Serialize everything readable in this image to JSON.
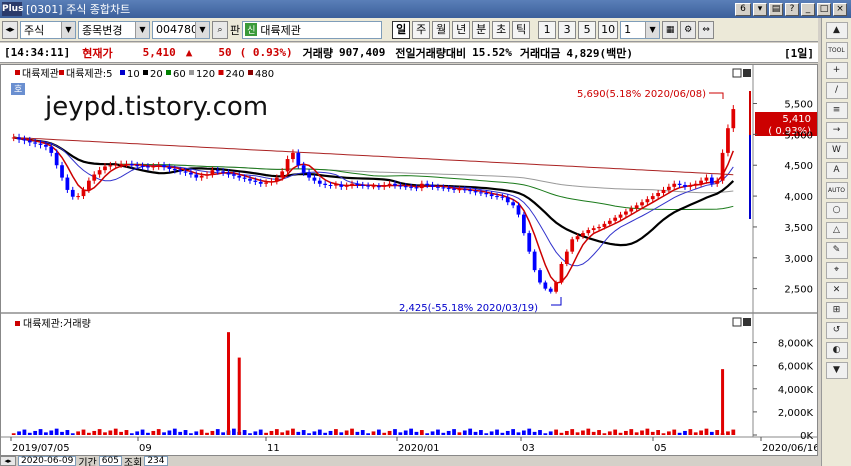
{
  "window": {
    "app_icon": "Plus",
    "title": "[0301] 주식 종합차트",
    "screen_number": "6",
    "controls": [
      "▾",
      "▤",
      "?",
      "_",
      "□",
      "×"
    ]
  },
  "toolbar": {
    "market": "주식",
    "mode": "종목변경",
    "code": "004780",
    "name_prefix": "판",
    "credit_tag": "신",
    "stock_name": "대륙제관",
    "periods": [
      "일",
      "주",
      "월",
      "년",
      "분",
      "초",
      "틱"
    ],
    "active_period": "일",
    "minute_buttons": [
      "1",
      "3",
      "5",
      "10"
    ],
    "interval_value": "1"
  },
  "quote": {
    "time": "[14:34:11]",
    "price_label": "현재가",
    "price": "5,410",
    "arrow": "▲",
    "change": "50",
    "change_pct": "( 0.93%)",
    "volume_label": "거래량",
    "volume": "907,409",
    "vol_ratio_label": "전일거래량대비",
    "vol_ratio": "15.52%",
    "amount_label": "거래대금",
    "amount": "4,829(백만)",
    "period_tag": "[1일]"
  },
  "watermark": "jeypd.tistory.com",
  "price_panel": {
    "legend": [
      "대륙제관",
      "대륙제관:5",
      "10",
      "20",
      "60",
      "120",
      "240",
      "480"
    ],
    "legend_colors": [
      "#cc0000",
      "#cc0000",
      "#0000cc",
      "#000000",
      "#008000",
      "#999999",
      "#cc0000",
      "#8b0000"
    ],
    "hoga_tag": "호",
    "max_annotation": "5,690(5.18% 2020/06/08)",
    "min_annotation": "2,425(-55.18% 2020/03/19)",
    "current_label": "5,410",
    "current_pct": "( 0.93%)",
    "y_ticks": [
      "5,500",
      "5,000",
      "4,500",
      "4,000",
      "3,500",
      "3,000",
      "2,500"
    ]
  },
  "volume_panel": {
    "legend": "대륙제관:거래량",
    "y_ticks": [
      "8,000K",
      "6,000K",
      "4,000K",
      "2,000K",
      "0K"
    ]
  },
  "x_axis": {
    "labels": [
      "2019/07/05",
      "09",
      "11",
      "2020/01",
      "03",
      "05",
      "2020/06/16"
    ]
  },
  "bottom": {
    "date": "2020-06-09",
    "period_label": "기간",
    "period_value": "605",
    "query_label": "조회",
    "query_value": "234"
  },
  "right_tools": [
    "▲",
    "TOOL",
    "+",
    "/",
    "≡",
    "→",
    "W",
    "A",
    "AUTO",
    "○",
    "△",
    "✎",
    "⌖",
    "✕",
    "⊞",
    "↺",
    "◐",
    "▼"
  ],
  "colors": {
    "up": "#e00000",
    "down": "#0000ff",
    "ma5": "#cc0000",
    "ma10": "#3333cc",
    "ma20": "#000000",
    "ma60": "#1a7a1a",
    "ma120": "#999999",
    "ma240": "#aa2222"
  },
  "chart_data": {
    "type": "candlestick",
    "x_start": "2019/07/05",
    "x_end": "2020/06/16",
    "price_ylim": [
      2300,
      5800
    ],
    "close_series": [
      4950,
      4920,
      4900,
      4870,
      4850,
      4830,
      4800,
      4700,
      4500,
      4300,
      4100,
      3990,
      4000,
      4100,
      4250,
      4350,
      4420,
      4480,
      4500,
      4510,
      4520,
      4520,
      4500,
      4490,
      4480,
      4470,
      4480,
      4500,
      4470,
      4440,
      4420,
      4400,
      4380,
      4350,
      4300,
      4330,
      4350,
      4420,
      4400,
      4380,
      4350,
      4330,
      4300,
      4280,
      4250,
      4230,
      4200,
      4220,
      4240,
      4300,
      4400,
      4600,
      4700,
      4500,
      4380,
      4300,
      4250,
      4200,
      4180,
      4170,
      4190,
      4150,
      4170,
      4200,
      4180,
      4170,
      4160,
      4160,
      4150,
      4180,
      4200,
      4170,
      4160,
      4150,
      4140,
      4130,
      4200,
      4180,
      4150,
      4140,
      4130,
      4120,
      4100,
      4110,
      4100,
      4080,
      4060,
      4050,
      4030,
      4000,
      3990,
      3980,
      3900,
      3850,
      3700,
      3400,
      3100,
      2800,
      2600,
      2500,
      2450,
      2600,
      2900,
      3100,
      3300,
      3350,
      3400,
      3450,
      3480,
      3500,
      3550,
      3600,
      3650,
      3700,
      3750,
      3800,
      3850,
      3900,
      3950,
      4000,
      4050,
      4100,
      4150,
      4200,
      4180,
      4150,
      4170,
      4200,
      4250,
      4300,
      4200,
      4250,
      4700,
      5100,
      5410
    ],
    "annotations": [
      {
        "label": "max",
        "value": 5690,
        "date": "2020/06/08"
      },
      {
        "label": "min",
        "value": 2425,
        "date": "2020/03/19"
      }
    ],
    "volume_ylim": [
      0,
      9000
    ],
    "volume_spikes_k": [
      {
        "date": "2019/11",
        "value": 8900
      },
      {
        "date": "2019/11",
        "value": 6700
      },
      {
        "date": "2020/06",
        "value": 5700
      }
    ]
  }
}
